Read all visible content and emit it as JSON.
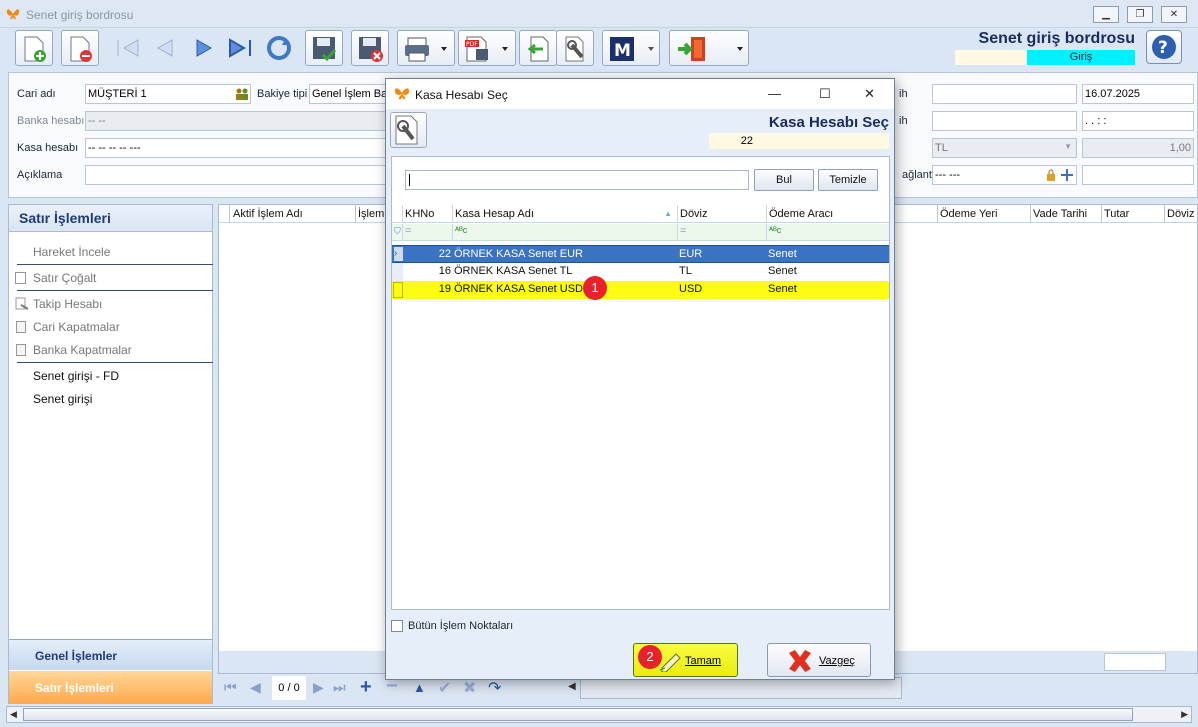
{
  "window": {
    "title": "Senet giriş bordrosu"
  },
  "header": {
    "title": "Senet giriş bordrosu",
    "mode": "Giriş"
  },
  "form": {
    "cari_label": "Cari adı",
    "cari_value": "MÜŞTERİ 1",
    "bakiye_label": "Bakiye tipi",
    "bakiye_value": "Genel İşlem Bak",
    "banka_label": "Banka hesabı",
    "banka_value": "-- --",
    "kasa_label": "Kasa hesabı",
    "kasa_value": "-- -- -- -- ---",
    "aciklama_label": "Açıklama",
    "tarih_label1": "ih",
    "tarih_label2": "ih",
    "date_value": "16.07.2025",
    "time_value": ". .   : :",
    "currency_value": "TL",
    "rate_value": "1,00",
    "baglanti_label": "ağlantı",
    "baglanti_value": "--- ---"
  },
  "left_panel": {
    "title": "Satır İşlemleri",
    "items": [
      "Hareket İncele",
      "Satır Çoğalt",
      "Takip Hesabı",
      "Cari Kapatmalar",
      "Banka Kapatmalar",
      "Senet girişi - FD",
      "Senet girişi"
    ],
    "genel": "Genel İşlemler",
    "satir": "Satır İşlemleri"
  },
  "grid": {
    "headers": [
      "Aktif İşlem Adı",
      "İşlem"
    ],
    "headers_right": [
      "Ödeme Yeri",
      "Vade Tarihi",
      "Tutar",
      "Döviz"
    ]
  },
  "navbar": {
    "page": "0 / 0"
  },
  "dialog": {
    "title": "Kasa Hesabı Seç",
    "heading": "Kasa Hesabı Seç",
    "selected_no": "22",
    "search_value": "",
    "find_button": "Bul",
    "clear_button": "Temizle",
    "columns": [
      "KHNo",
      "Kasa Hesap Adı",
      "Döviz",
      "Ödeme Aracı"
    ],
    "filter_eq": "=",
    "filter_abc": "ᴬᴮc",
    "rows": [
      {
        "no": "22",
        "name": "ÖRNEK KASA Senet EUR",
        "doviz": "EUR",
        "arac": "Senet"
      },
      {
        "no": "16",
        "name": "ÖRNEK KASA Senet TL",
        "doviz": "TL",
        "arac": "Senet"
      },
      {
        "no": "19",
        "name": "ÖRNEK KASA Senet USD",
        "doviz": "USD",
        "arac": "Senet"
      }
    ],
    "all_points_label": "Bütün İşlem Noktaları",
    "ok_button": "Tamam",
    "cancel_button": "Vazgeç",
    "badge1": "1",
    "badge2": "2"
  },
  "colors": {
    "accent": "#1a2c5b",
    "selected_row": "#3b73c3",
    "highlight_row": "#fcfc12",
    "badge": "#e8222a",
    "orange": "#ffa94b"
  }
}
